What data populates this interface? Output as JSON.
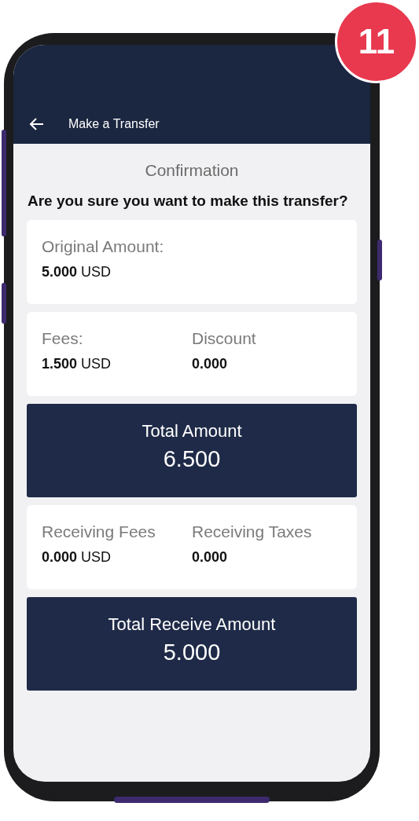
{
  "step_badge": "11",
  "header": {
    "title": "Make a Transfer"
  },
  "section_title": "Confirmation",
  "question": "Are you sure you want to make this transfer?",
  "cards": [
    {
      "kind": "info",
      "fields": [
        {
          "label": "Original Amount:",
          "value": "5.000",
          "unit": "USD"
        }
      ]
    },
    {
      "kind": "info",
      "fields": [
        {
          "label": "Fees:",
          "value": "1.500",
          "unit": "USD"
        },
        {
          "label": "Discount",
          "value": "0.000"
        }
      ]
    },
    {
      "kind": "total",
      "label": "Total Amount",
      "value": "6.500"
    },
    {
      "kind": "info",
      "fields": [
        {
          "label": "Receiving Fees",
          "value": "0.000",
          "unit": "USD"
        },
        {
          "label": "Receiving Taxes",
          "value": "0.000"
        }
      ]
    },
    {
      "kind": "total",
      "label": "Total Receive Amount",
      "value": "5.000"
    }
  ]
}
